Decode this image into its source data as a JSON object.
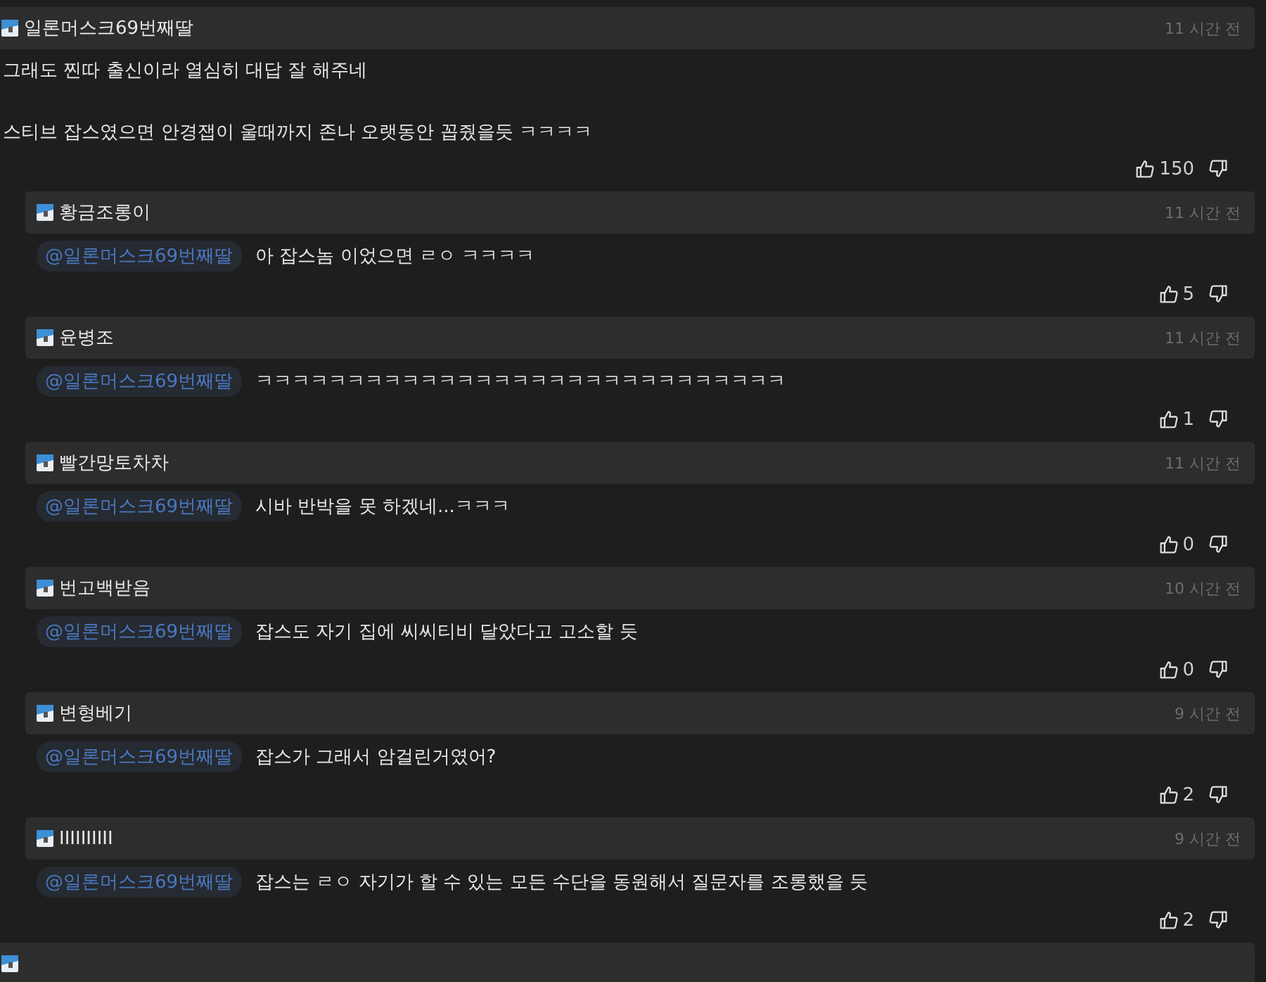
{
  "comment": {
    "author": "일론머스크69번째딸",
    "time": "11 시간 전",
    "lines": [
      "그래도 찐따 출신이라 열심히 대답 잘 해주네",
      "스티브 잡스였으면 안경잽이 울때까지 존나 오랫동안 꼽줬을듯 ㅋㅋㅋㅋ"
    ],
    "likes": "150"
  },
  "replies": [
    {
      "author": "황금조롱이",
      "time": "11 시간 전",
      "mention": "@일론머스크69번째딸",
      "text": "아 잡스놈 이었으면 ㄹㅇ ㅋㅋㅋㅋ",
      "likes": "5"
    },
    {
      "author": "윤병조",
      "time": "11 시간 전",
      "mention": "@일론머스크69번째딸",
      "text": "ㅋㅋㅋㅋㅋㅋㅋㅋㅋㅋㅋㅋㅋㅋㅋㅋㅋㅋㅋㅋㅋㅋㅋㅋㅋㅋㅋㅋㅋ",
      "likes": "1"
    },
    {
      "author": "빨간망토차차",
      "time": "11 시간 전",
      "mention": "@일론머스크69번째딸",
      "text": "시바 반박을 못 하겠네...ㅋㅋㅋ",
      "likes": "0"
    },
    {
      "author": "번고백받음",
      "time": "10 시간 전",
      "mention": "@일론머스크69번째딸",
      "text": "잡스도 자기 집에 씨씨티비 달았다고 고소할 듯",
      "likes": "0"
    },
    {
      "author": "변형베기",
      "time": "9 시간 전",
      "mention": "@일론머스크69번째딸",
      "text": "잡스가 그래서 암걸린거였어?",
      "likes": "2"
    },
    {
      "author": "IIIIIIIIII",
      "time": "9 시간 전",
      "mention": "@일론머스크69번째딸",
      "text": "잡스는 ㄹㅇ 자기가 할 수 있는 모든 수단을 동원해서 질문자를 조롱했을 듯",
      "likes": "2"
    }
  ]
}
